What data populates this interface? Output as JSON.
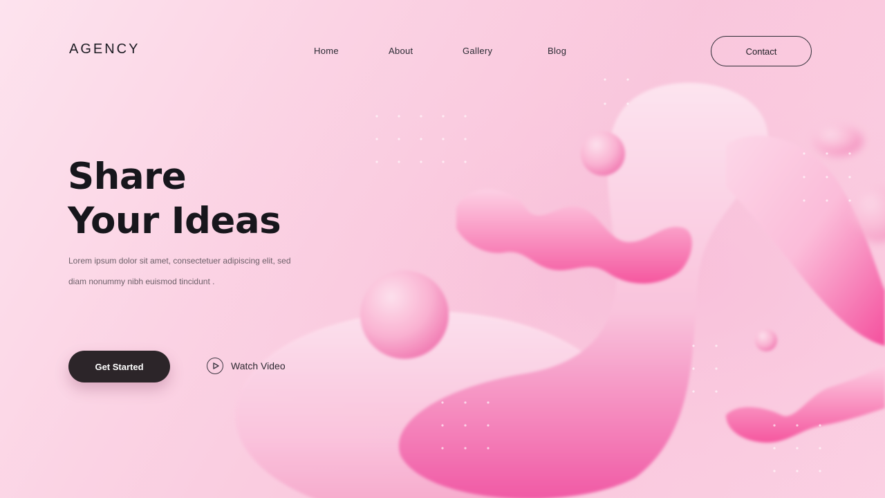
{
  "brand": {
    "logo": "AGENCY"
  },
  "nav": {
    "items": [
      {
        "label": "Home"
      },
      {
        "label": "About"
      },
      {
        "label": "Gallery"
      },
      {
        "label": "Blog"
      }
    ],
    "contact_label": "Contact"
  },
  "hero": {
    "title_line_1": "Share",
    "title_line_2": "Your Ideas",
    "description_line_1": "Lorem ipsum dolor sit amet, consectetuer adipiscing elit, sed",
    "description_line_2": "diam nonummy nibh euismod tincidunt .",
    "cta_label": "Get Started",
    "watch_label": "Watch Video"
  },
  "icons": {
    "play": "play-icon"
  },
  "colors": {
    "background": "#fbd3e4",
    "accent": "#f45aa8",
    "button_dark": "#2c2529",
    "text_dark": "#17161c"
  }
}
